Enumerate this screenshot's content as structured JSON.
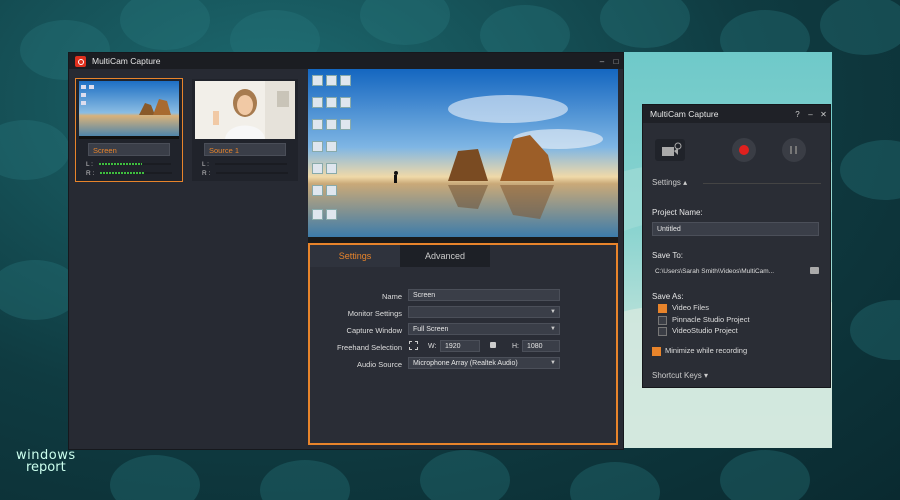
{
  "main_window": {
    "title": "MultiCam Capture",
    "minimize": "–",
    "maximize": "□"
  },
  "sources": [
    {
      "name": "Screen",
      "meter_l": "L :",
      "meter_r": "R :"
    },
    {
      "name": "Source 1",
      "meter_l": "L :",
      "meter_r": "R :"
    }
  ],
  "settings": {
    "tabs": [
      {
        "label": "Settings"
      },
      {
        "label": "Advanced"
      }
    ],
    "name_label": "Name",
    "name_value": "Screen",
    "monitor_label": "Monitor Settings",
    "monitor_value": "",
    "capture_label": "Capture Window",
    "capture_value": "Full Screen",
    "freehand_label": "Freehand Selection",
    "w_label": "W:",
    "w_value": "1920",
    "h_label": "H:",
    "h_value": "1080",
    "audio_label": "Audio Source",
    "audio_value": "Microphone Array (Realtek Audio)"
  },
  "small_window": {
    "title": "MultiCam Capture",
    "help": "?",
    "minimize": "–",
    "close": "✕",
    "settings_label": "Settings ▴",
    "project_name_label": "Project Name:",
    "project_name_value": "Untitled",
    "save_to_label": "Save To:",
    "save_to_value": "C:\\Users\\Sarah Smith\\Videos\\MultiCam...",
    "save_as_label": "Save As:",
    "options": [
      {
        "label": "Video Files",
        "checked": true
      },
      {
        "label": "Pinnacle Studio Project",
        "checked": false
      },
      {
        "label": "VideoStudio Project",
        "checked": false
      }
    ],
    "minimize_label": "Minimize while recording",
    "minimize_checked": true,
    "shortcut_label": "Shortcut Keys ▾"
  },
  "brand": {
    "line1": "windows",
    "line2": "report"
  },
  "colors": {
    "accent": "#e8842b",
    "record": "#e0201e"
  }
}
